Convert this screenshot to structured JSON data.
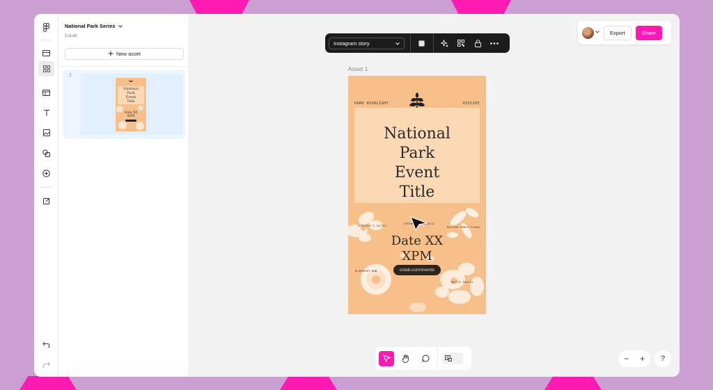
{
  "colors": {
    "accent": "#ff1bb3",
    "background": "#cc9fd3",
    "story_bg": "#f7c08a"
  },
  "project": {
    "title": "National Park Series",
    "subtitle": "CoLab"
  },
  "panel": {
    "new_asset_label": "New asset",
    "assets": [
      {
        "number": "1"
      }
    ]
  },
  "thumbnail": {
    "title_lines": [
      "National",
      "Park",
      "Event",
      "Title"
    ],
    "date_lines": [
      "Date XX",
      "XPM"
    ]
  },
  "toolbar": {
    "preset_label": "Instagram story"
  },
  "canvas": {
    "asset_label": "Asset 1"
  },
  "story": {
    "highlight_label": "PARK HIGHLIGHT",
    "code": "4325205",
    "title_lines": [
      "National",
      "Park",
      "Event",
      "Title"
    ],
    "date_lines": [
      "Date XX",
      "XPM"
    ],
    "url": "colab.com/events",
    "tiny_labels": [
      "SCRATCHY'S CACTUS",
      "SPRINKLER MARIGOLD",
      "MACHINE MANIA FLORAL",
      "BLUEBERRY BOW",
      "WAFFLE DAHLIA"
    ]
  },
  "actions": {
    "export_label": "Export",
    "share_label": "Share"
  },
  "zoom": {
    "minus": "−",
    "plus": "+",
    "help": "?"
  },
  "icons": [
    "figma-icon",
    "frame-icon",
    "grid-icon",
    "layout-icon",
    "text-icon",
    "image-icon",
    "shapes-icon",
    "plus-circle-icon",
    "edit-icon",
    "undo-icon",
    "redo-icon",
    "chevron-down-icon",
    "plus-icon",
    "color-swatch-icon",
    "sparkle-icon",
    "qr-icon",
    "lock-icon",
    "more-icon",
    "pointer-icon",
    "hand-icon",
    "comment-icon",
    "library-icon",
    "cursor-icon"
  ]
}
